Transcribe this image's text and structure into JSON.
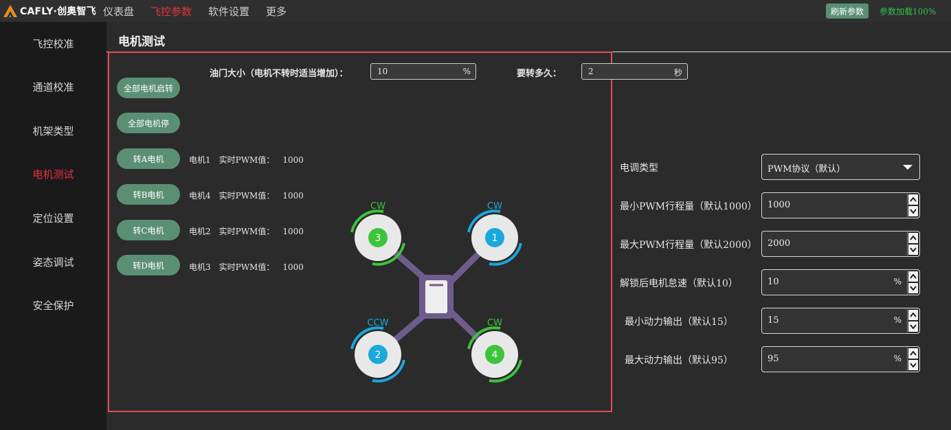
{
  "brand": {
    "name": "CAFLY·创奥智飞"
  },
  "nav": {
    "items": [
      {
        "label": "仪表盘",
        "active": false
      },
      {
        "label": "飞控参数",
        "active": true
      },
      {
        "label": "软件设置",
        "active": false
      },
      {
        "label": "更多",
        "active": false
      }
    ]
  },
  "header": {
    "refresh_label": "刷新参数",
    "load_status": "参数加载100%"
  },
  "sidebar": {
    "items": [
      {
        "label": "飞控校准",
        "active": false
      },
      {
        "label": "通道校准",
        "active": false
      },
      {
        "label": "机架类型",
        "active": false
      },
      {
        "label": "电机测试",
        "active": true
      },
      {
        "label": "定位设置",
        "active": false
      },
      {
        "label": "姿态调试",
        "active": false
      },
      {
        "label": "安全保护",
        "active": false
      }
    ]
  },
  "page": {
    "title": "电机测试"
  },
  "motor_test": {
    "throttle_label": "油门大小（电机不转时适当增加）：",
    "throttle_value": "10",
    "throttle_unit": "%",
    "duration_label": "要转多久：",
    "duration_value": "2",
    "duration_unit": "秒",
    "all_start_label": "全部电机启转",
    "all_stop_label": "全部电机停",
    "motors": [
      {
        "button": "转A电机",
        "motor": "电机1",
        "pwm_label": "实时PWM值：",
        "pwm": "1000"
      },
      {
        "button": "转B电机",
        "motor": "电机4",
        "pwm_label": "实时PWM值：",
        "pwm": "1000"
      },
      {
        "button": "转C电机",
        "motor": "电机2",
        "pwm_label": "实时PWM值：",
        "pwm": "1000"
      },
      {
        "button": "转D电机",
        "motor": "电机3",
        "pwm_label": "实时PWM值：",
        "pwm": "1000"
      }
    ],
    "diagram": {
      "rotors": [
        {
          "number": "3",
          "direction": "CW",
          "color": "#3cc43c"
        },
        {
          "number": "1",
          "direction": "CW",
          "color": "#1aa8dd"
        },
        {
          "number": "2",
          "direction": "CCW",
          "color": "#1aa8dd"
        },
        {
          "number": "4",
          "direction": "CW",
          "color": "#3cc43c"
        }
      ],
      "frame_color": "#6e5d8c"
    }
  },
  "esc_settings": {
    "esc_type_label": "电调类型",
    "esc_type_value": "PWM协议（默认）",
    "fields": [
      {
        "label": "最小PWM行程量（默认1000）",
        "value": "1000",
        "unit": ""
      },
      {
        "label": "最大PWM行程量（默认2000）",
        "value": "2000",
        "unit": ""
      },
      {
        "label": "解锁后电机怠速（默认10）",
        "value": "10",
        "unit": "%"
      },
      {
        "label": "最小动力输出（默认15）",
        "value": "15",
        "unit": "%"
      },
      {
        "label": "最大动力输出（默认95）",
        "value": "95",
        "unit": "%"
      }
    ]
  },
  "colors": {
    "accent_red": "#e8323c",
    "button_green": "#5b8f73",
    "status_green": "#2ec24a",
    "highlight_border": "#e84c55"
  }
}
